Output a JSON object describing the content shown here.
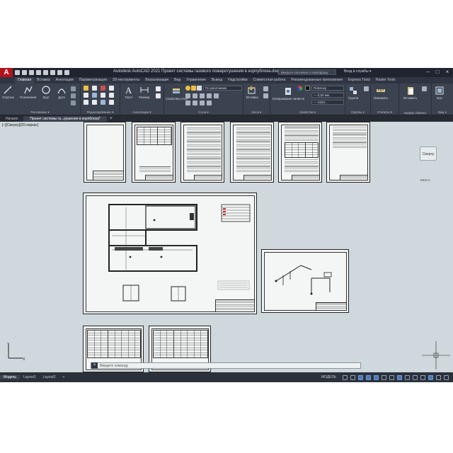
{
  "app": {
    "logo": "A",
    "title": "Autodesk AutoCAD 2021   Проект системы газового пожаротушения в корпублока.dwg",
    "search_placeholder": "Введите ключевое слово/фразу",
    "signin": "Вход в службы ▾"
  },
  "ribbon_tabs": [
    "Главная",
    "Вставка",
    "Аннотации",
    "Параметризация",
    "3D-инструменты",
    "Визуализация",
    "Вид",
    "Управление",
    "Вывод",
    "Надстройки",
    "Совместная работа",
    "Рекомендованные приложения",
    "Express Tools",
    "Raster Tools"
  ],
  "active_ribbon_tab": "Главная",
  "ribbon": {
    "draw": {
      "line": "Отрезок",
      "polyline": "Полилиния",
      "circle": "Круг",
      "arc": "Дуга",
      "label": "Рисование ▾"
    },
    "modify": {
      "label": "Редактирование ▾"
    },
    "annotation": {
      "text": "Текст",
      "dimension": "Размер",
      "label": "Аннотации ▾"
    },
    "layers": {
      "layer_props": "Свойства слоя",
      "current_layer": "По умолчанию",
      "label": "Слои ▾"
    },
    "block": {
      "insert": "Вставка",
      "label": "Блок ▾"
    },
    "properties": {
      "match": "Копирование свойств",
      "color": "ПоБлоку",
      "lineweight": "— 0,00 мм",
      "linetype": "— Solid...",
      "label": "Свойства ▾"
    },
    "groups": {
      "group": "Группа",
      "label": "Группы ▾"
    },
    "utilities": {
      "measure": "Измерить",
      "label": "Утилиты ▾"
    },
    "clipboard": {
      "paste": "Вставить",
      "label": "Буфер обмена"
    },
    "view": {
      "base": "Баз",
      "label": "Вид ▾"
    }
  },
  "doc_tabs": [
    "Начало",
    "Проект системы га...рушения в корпблока*"
  ],
  "active_doc_tab": 1,
  "canvas": {
    "viewport_label": "[–][Сверху][2D-каркас]",
    "viewcube_face": "Сверху",
    "wcs": "МСК ▾",
    "command_prompt": "Введите команду"
  },
  "status": {
    "tabs": [
      "Модель",
      "Layout1",
      "Layout2"
    ],
    "active_tab": "Модель",
    "model_label": "МОДЕЛЬ"
  },
  "colors": {
    "canvas_bg": "#cfd8dc",
    "ribbon_bg": "#3c4350",
    "accent": "#4f7ab7",
    "logo_red": "#b3111c"
  }
}
